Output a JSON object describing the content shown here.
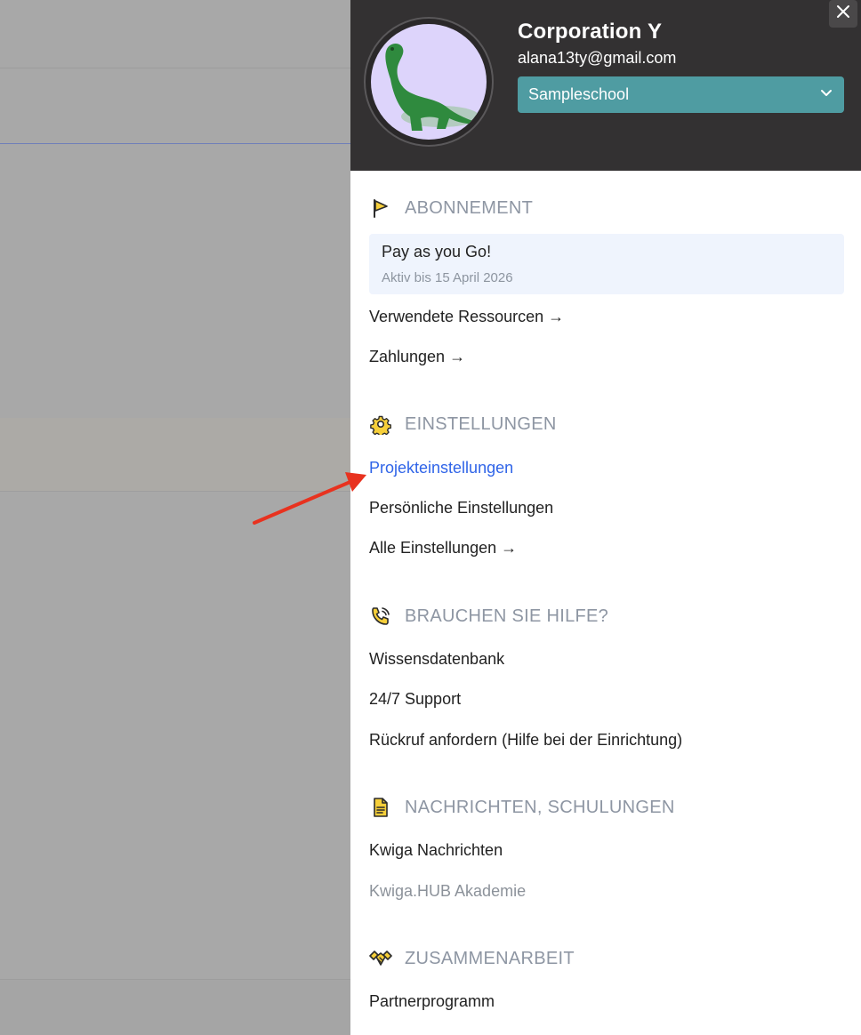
{
  "header": {
    "org_name": "Corporation Y",
    "email": "alana13ty@gmail.com",
    "school_select": "Sampleschool"
  },
  "sections": {
    "subscription": {
      "title": "ABONNEMENT",
      "plan_name": "Pay as you Go!",
      "plan_status": "Aktiv bis 15 April 2026",
      "links": [
        "Verwendete Ressourcen →",
        "Zahlungen →"
      ]
    },
    "settings": {
      "title": "EINSTELLUNGEN",
      "links": [
        "Projekteinstellungen",
        "Persönliche Einstellungen",
        "Alle Einstellungen →"
      ]
    },
    "help": {
      "title": "BRAUCHEN SIE HILFE?",
      "links": [
        "Wissensdatenbank",
        "24/7 Support",
        "Rückruf anfordern (Hilfe bei der Einrichtung)"
      ]
    },
    "news": {
      "title": "NACHRICHTEN, SCHULUNGEN",
      "links": [
        "Kwiga Nachrichten",
        "Kwiga.HUB Akademie"
      ]
    },
    "collab": {
      "title": "ZUSAMMENARBEIT",
      "links": [
        "Partnerprogramm"
      ]
    }
  },
  "colors": {
    "header_bg": "#333132",
    "select_bg": "#4f9ca2",
    "active_link": "#2f64e8",
    "annotation_arrow": "#e8321f"
  },
  "icons": [
    "close-icon",
    "chevron-down-icon",
    "flag-icon",
    "gear-icon",
    "phone-icon",
    "document-icon",
    "handshake-icon",
    "dinosaur-avatar"
  ]
}
